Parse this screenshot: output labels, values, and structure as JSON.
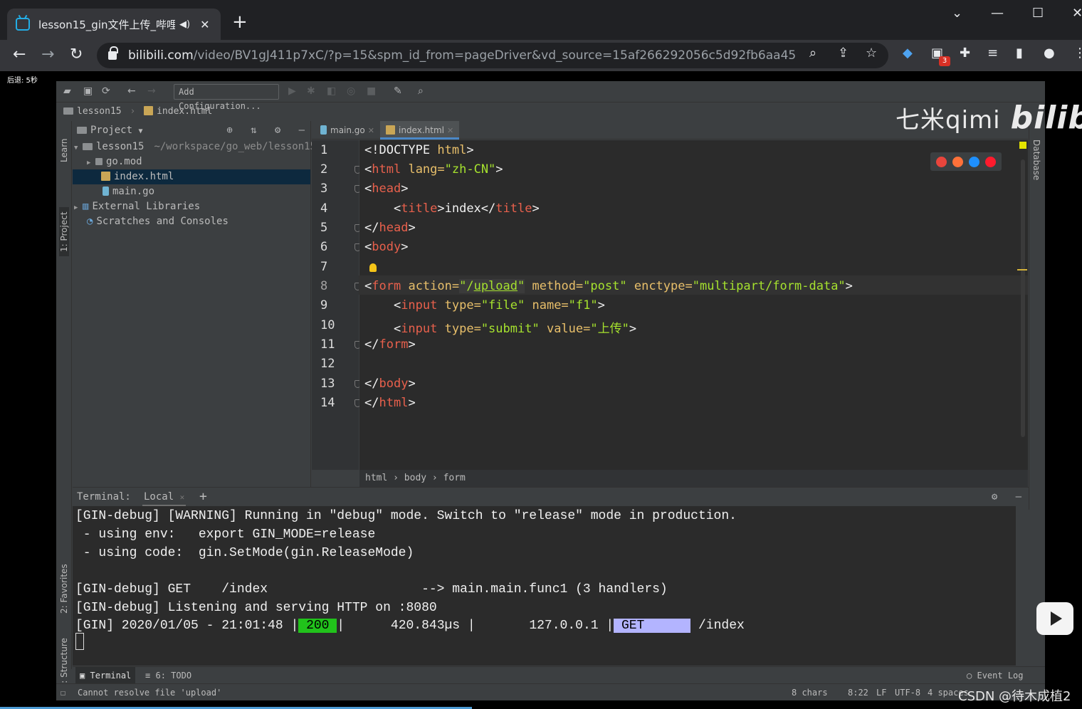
{
  "browser": {
    "tab_title": "lesson15_gin文件上传_哔哩",
    "new_tab": "+",
    "url_domain": "bilibili.com",
    "url_path": "/video/BV1gJ411p7xC/?p=15&spm_id_from=pageDriver&vd_source=15af266292056c5d92fb6aa45...",
    "extension_badge": "3"
  },
  "countdown": "后退: 5秒",
  "ide": {
    "add_configuration": "Add Configuration...",
    "breadcrumb_top": [
      "lesson15",
      "index.html"
    ],
    "left_strip": [
      "Learn",
      "1: Project",
      "2: Favorites",
      "Z: Structure"
    ],
    "right_strip": "Database",
    "project_header": "Project",
    "tree": [
      {
        "name": "lesson15",
        "path": "~/workspace/go_web/lesson15"
      },
      {
        "name": "go.mod"
      },
      {
        "name": "index.html"
      },
      {
        "name": "main.go"
      },
      {
        "name": "External Libraries"
      },
      {
        "name": "Scratches and Consoles"
      }
    ],
    "editor_tabs": [
      "main.go",
      "index.html"
    ],
    "line_numbers": [
      "1",
      "2",
      "3",
      "4",
      "5",
      "6",
      "7",
      "8",
      "9",
      "10",
      "11",
      "12",
      "13",
      "14"
    ],
    "code_breadcrumbs": "html › body › form",
    "terminal": {
      "label": "Terminal:",
      "tab": "Local",
      "lines": [
        "[GIN-debug] [WARNING] Running in \"debug\" mode. Switch to \"release\" mode in production.",
        " - using env:   export GIN_MODE=release",
        " - using code:  gin.SetMode(gin.ReleaseMode)",
        "",
        "[GIN-debug] GET    /index                    --> main.main.func1 (3 handlers)",
        "[GIN-debug] Listening and serving HTTP on :8080"
      ],
      "gin_prefix": "[GIN] 2020/01/05 - 21:01:48 |",
      "status_code": " 200 ",
      "latency": "|      420.843µs |       127.0.0.1 |",
      "method": " GET      ",
      "path": " /index"
    },
    "bottom_tabs": [
      "Terminal",
      "6: TODO"
    ],
    "event_log": "Event Log",
    "status": {
      "message": "Cannot resolve file 'upload'",
      "chars": "8 chars",
      "position": "8:22",
      "line_sep": "LF",
      "encoding": "UTF-8",
      "indent": "4 spaces"
    }
  },
  "overlay": {
    "watermark_text": "七米qimi",
    "watermark_logo": "bilibili",
    "csdn": "CSDN @待木成植2"
  }
}
